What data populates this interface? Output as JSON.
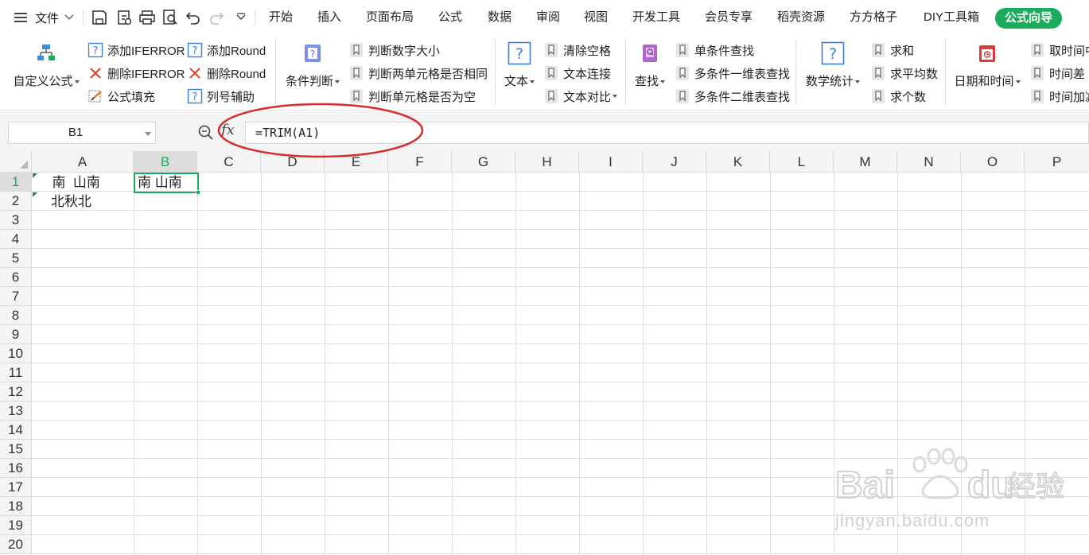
{
  "menu": {
    "file_label": "文件",
    "tabs": [
      "开始",
      "插入",
      "页面布局",
      "公式",
      "数据",
      "审阅",
      "视图",
      "开发工具",
      "会员专享",
      "稻壳资源",
      "方方格子",
      "DIY工具箱"
    ],
    "active_tab": "公式向导",
    "accent_color": "#1aab5c"
  },
  "ribbon": {
    "custom_formula": "自定义公式",
    "add_iferror": "添加IFERROR",
    "del_iferror": "删除IFERROR",
    "formula_fill": "公式填充",
    "add_round": "添加Round",
    "del_round": "删除Round",
    "col_helper": "列号辅助",
    "cond_judge": "条件判断",
    "judge_num_size": "判断数字大小",
    "judge_two_cells": "判断两单元格是否相同",
    "judge_cell_empty": "判断单元格是否为空",
    "text": "文本",
    "clear_spaces": "清除空格",
    "text_concat": "文本连接",
    "text_compare": "文本对比",
    "lookup": "查找",
    "single_lookup": "单条件查找",
    "multi_1d_lookup": "多条件一维表查找",
    "multi_2d_lookup": "多条件二维表查找",
    "math_stats": "数学统计",
    "sum": "求和",
    "average": "求平均数",
    "count": "求个数",
    "datetime": "日期和时间",
    "take_time": "取时间中",
    "time_diff": "时间差",
    "time_add": "时间加减"
  },
  "formula_bar": {
    "name_box": "B1",
    "fx_label": "fx",
    "formula": "=TRIM(A1)"
  },
  "sheet": {
    "columns": [
      "A",
      "B",
      "C",
      "D",
      "E",
      "F",
      "G",
      "H",
      "I",
      "J",
      "K",
      "L",
      "M",
      "N",
      "O",
      "P"
    ],
    "rows": [
      "1",
      "2",
      "3",
      "4",
      "5",
      "6",
      "7",
      "8",
      "9",
      "10",
      "11",
      "12",
      "13",
      "14",
      "15",
      "16",
      "17",
      "18",
      "19",
      "20"
    ],
    "selected_cell": "B1",
    "cells": {
      "A1": "  南  山南",
      "A2": "北秋北",
      "B1": "南 山南"
    }
  },
  "annotation": {
    "ellipse_color": "#d62c2c"
  },
  "watermark": {
    "brand": "Baidu经验",
    "url": "jingyan.baidu.com"
  }
}
